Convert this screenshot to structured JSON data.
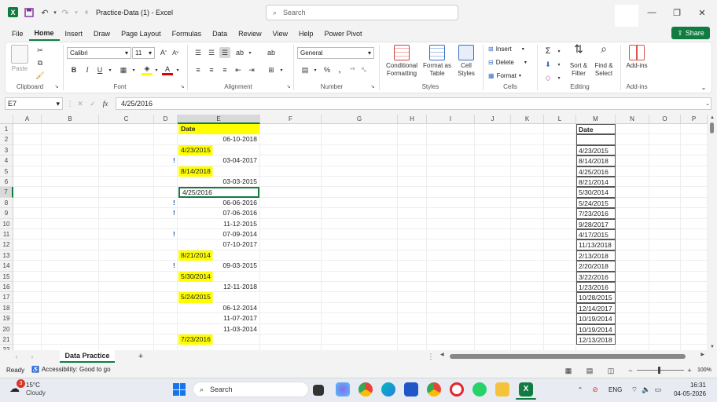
{
  "titlebar": {
    "title": "Practice-Data (1)  -  Excel",
    "search_placeholder": "Search",
    "minimize": "—",
    "maximize": "❐",
    "close": "✕"
  },
  "menu": {
    "tabs": [
      "File",
      "Home",
      "Insert",
      "Draw",
      "Page Layout",
      "Formulas",
      "Data",
      "Review",
      "View",
      "Help",
      "Power Pivot"
    ],
    "active": "Home",
    "share_label": "Share"
  },
  "ribbon": {
    "clipboard": {
      "paste": "Paste",
      "label": "Clipboard"
    },
    "font": {
      "name": "Calibri",
      "size": "11",
      "label": "Font"
    },
    "alignment": {
      "label": "Alignment"
    },
    "number": {
      "format": "General",
      "label": "Number"
    },
    "styles": {
      "conditional": "Conditional Formatting",
      "format_table": "Format as Table",
      "cell_styles": "Cell Styles",
      "label": "Styles"
    },
    "cells": {
      "insert": "Insert",
      "delete": "Delete",
      "format": "Format",
      "label": "Cells"
    },
    "editing": {
      "sort": "Sort & Filter",
      "find": "Find & Select",
      "label": "Editing"
    },
    "addins": {
      "button": "Add-ins",
      "label": "Add-ins"
    }
  },
  "formula_bar": {
    "name_box": "E7",
    "fx": "fx",
    "value": "4/25/2016"
  },
  "grid": {
    "columns": [
      "A",
      "B",
      "C",
      "D",
      "E",
      "F",
      "G",
      "H",
      "I",
      "J",
      "K",
      "L",
      "M",
      "N",
      "O",
      "P"
    ],
    "rows": [
      "1",
      "2",
      "3",
      "4",
      "5",
      "6",
      "7",
      "8",
      "9",
      "10",
      "11",
      "12",
      "13",
      "14",
      "15",
      "16",
      "17",
      "18",
      "19",
      "20",
      "21",
      "22"
    ],
    "col_e": [
      {
        "text": "Date",
        "hl": true,
        "align": "left",
        "bold": true
      },
      {
        "text": "06-10-2018",
        "hl": false,
        "align": "right"
      },
      {
        "text": "4/23/2015",
        "hl": true,
        "align": "left"
      },
      {
        "text": "03-04-2017",
        "hl": false,
        "align": "right"
      },
      {
        "text": "8/14/2018",
        "hl": true,
        "align": "left"
      },
      {
        "text": "03-03-2015",
        "hl": false,
        "align": "right"
      },
      {
        "text": "4/25/2016",
        "hl": false,
        "align": "left",
        "selected": true
      },
      {
        "text": "06-06-2016",
        "hl": false,
        "align": "right"
      },
      {
        "text": "07-06-2016",
        "hl": false,
        "align": "right"
      },
      {
        "text": "11-12-2015",
        "hl": false,
        "align": "right"
      },
      {
        "text": "07-09-2014",
        "hl": false,
        "align": "right"
      },
      {
        "text": "07-10-2017",
        "hl": false,
        "align": "right"
      },
      {
        "text": "8/21/2014",
        "hl": true,
        "align": "left"
      },
      {
        "text": "09-03-2015",
        "hl": false,
        "align": "right"
      },
      {
        "text": "5/30/2014",
        "hl": true,
        "align": "left"
      },
      {
        "text": "12-11-2018",
        "hl": false,
        "align": "right"
      },
      {
        "text": "5/24/2015",
        "hl": true,
        "align": "left"
      },
      {
        "text": "06-12-2014",
        "hl": false,
        "align": "right"
      },
      {
        "text": "11-07-2017",
        "hl": false,
        "align": "right"
      },
      {
        "text": "11-03-2014",
        "hl": false,
        "align": "right"
      },
      {
        "text": "7/23/2016",
        "hl": true,
        "align": "left"
      }
    ],
    "col_d_markers": [
      "",
      "",
      "",
      "!",
      "",
      "",
      "",
      "!",
      "!",
      "",
      "!",
      "",
      "",
      "!",
      "",
      "",
      "",
      "",
      "",
      "",
      ""
    ],
    "col_m": [
      "Date",
      "",
      "4/23/2015",
      "8/14/2018",
      "4/25/2016",
      "8/21/2014",
      "5/30/2014",
      "5/24/2015",
      "7/23/2016",
      "9/28/2017",
      "4/17/2015",
      "11/13/2018",
      "2/13/2018",
      "2/20/2018",
      "3/22/2016",
      "1/23/2016",
      "10/28/2015",
      "12/14/2017",
      "10/19/2014",
      "10/19/2014",
      "12/13/2018"
    ]
  },
  "sheets": {
    "active": "Data Practice",
    "add": "+"
  },
  "status": {
    "ready": "Ready",
    "accessibility": "Accessibility: Good to go",
    "zoom": "100%"
  },
  "taskbar": {
    "weather_temp": "15°C",
    "weather_desc": "Cloudy",
    "search": "Search",
    "lang": "ENG",
    "time": "16:31",
    "date": "04-05-2026",
    "badge": "3"
  },
  "colors": {
    "accent": "#107c41",
    "highlight": "#ffff00"
  }
}
